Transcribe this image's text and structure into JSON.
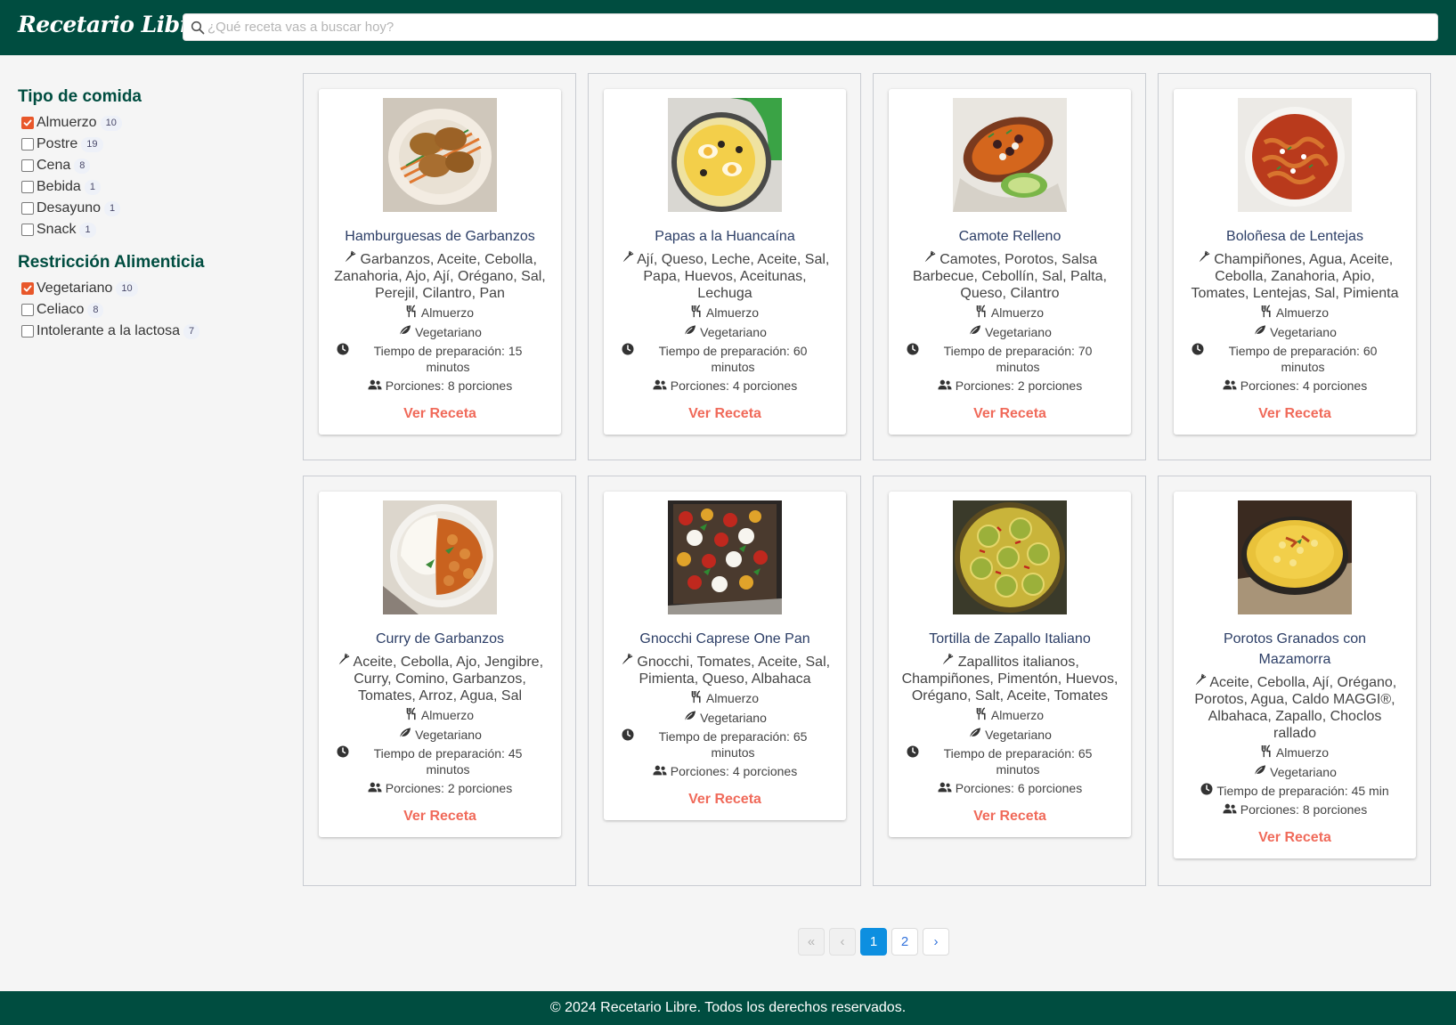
{
  "app": {
    "brand": "Recetario Libre"
  },
  "search": {
    "placeholder": "¿Qué receta vas a buscar hoy?"
  },
  "colors": {
    "primary": "#004d40",
    "accent": "#e8572a",
    "link": "#f06a5a",
    "active_page": "#0d8fe0"
  },
  "filters": {
    "tipo": {
      "title": "Tipo de comida",
      "items": [
        {
          "label": "Almuerzo",
          "count": "10",
          "checked": true
        },
        {
          "label": "Postre",
          "count": "19",
          "checked": false
        },
        {
          "label": "Cena",
          "count": "8",
          "checked": false
        },
        {
          "label": "Bebida",
          "count": "1",
          "checked": false
        },
        {
          "label": "Desayuno",
          "count": "1",
          "checked": false
        },
        {
          "label": "Snack",
          "count": "1",
          "checked": false
        }
      ]
    },
    "restriccion": {
      "title": "Restricción Alimenticia",
      "items": [
        {
          "label": "Vegetariano",
          "count": "10",
          "checked": true
        },
        {
          "label": "Celiaco",
          "count": "8",
          "checked": false
        },
        {
          "label": "Intolerante a la lactosa",
          "count": "7",
          "checked": false
        }
      ]
    }
  },
  "recipes": [
    {
      "title": "Hamburguesas de Garbanzos",
      "ingredients": "Garbanzos, Aceite, Cebolla, Zanahoria, Ajo, Ají, Orégano, Sal, Perejil, Cilantro, Pan",
      "meal": "Almuerzo",
      "diet": "Vegetariano",
      "time": "Tiempo de preparación: 15 minutos",
      "portions": "Porciones: 8 porciones",
      "cta": "Ver Receta",
      "image": "chickpea-patties-photo"
    },
    {
      "title": "Papas a la Huancaína",
      "ingredients": "Ají, Queso, Leche, Aceite, Sal, Papa, Huevos, Aceitunas, Lechuga",
      "meal": "Almuerzo",
      "diet": "Vegetariano",
      "time": "Tiempo de preparación: 60 minutos",
      "portions": "Porciones: 4 porciones",
      "cta": "Ver Receta",
      "image": "papas-huancaina-photo"
    },
    {
      "title": "Camote Relleno",
      "ingredients": "Camotes, Porotos, Salsa Barbecue, Cebollín, Sal, Palta, Queso, Cilantro",
      "meal": "Almuerzo",
      "diet": "Vegetariano",
      "time": "Tiempo de preparación: 70 minutos",
      "portions": "Porciones: 2 porciones",
      "cta": "Ver Receta",
      "image": "stuffed-sweet-potato-photo"
    },
    {
      "title": "Boloñesa de Lentejas",
      "ingredients": "Champiñones, Agua, Aceite, Cebolla, Zanahoria, Apio, Tomates, Lentejas, Sal, Pimienta",
      "meal": "Almuerzo",
      "diet": "Vegetariano",
      "time": "Tiempo de preparación: 60 minutos",
      "portions": "Porciones: 4 porciones",
      "cta": "Ver Receta",
      "image": "lentil-bolognese-photo"
    },
    {
      "title": "Curry de Garbanzos",
      "ingredients": "Aceite, Cebolla, Ajo, Jengibre, Curry, Comino, Garbanzos, Tomates, Arroz, Agua, Sal",
      "meal": "Almuerzo",
      "diet": "Vegetariano",
      "time": "Tiempo de preparación: 45 minutos",
      "portions": "Porciones: 2 porciones",
      "cta": "Ver Receta",
      "image": "chickpea-curry-photo"
    },
    {
      "title": "Gnocchi Caprese One Pan",
      "ingredients": "Gnocchi, Tomates, Aceite, Sal, Pimienta, Queso, Albahaca",
      "meal": "Almuerzo",
      "diet": "Vegetariano",
      "time": "Tiempo de preparación: 65 minutos",
      "portions": "Porciones: 4 porciones",
      "cta": "Ver Receta",
      "image": "gnocchi-caprese-photo"
    },
    {
      "title": "Tortilla de Zapallo Italiano",
      "ingredients": "Zapallitos italianos, Champiñones, Pimentón, Huevos, Orégano, Salt, Aceite, Tomates",
      "meal": "Almuerzo",
      "diet": "Vegetariano",
      "time": "Tiempo de preparación: 65 minutos",
      "portions": "Porciones: 6 porciones",
      "cta": "Ver Receta",
      "image": "zucchini-tortilla-photo"
    },
    {
      "title": "Porotos Granados con Mazamorra",
      "ingredients": "Aceite, Cebolla, Ají, Orégano, Porotos, Agua, Caldo MAGGI®, Albahaca, Zapallo, Choclos rallado",
      "meal": "Almuerzo",
      "diet": "Vegetariano",
      "time": "Tiempo de preparación: 45 min",
      "portions": "Porciones: 8 porciones",
      "cta": "Ver Receta",
      "image": "porotos-granados-photo"
    }
  ],
  "pagination": {
    "first": "«",
    "prev": "‹",
    "pages": [
      "1",
      "2"
    ],
    "current": "1",
    "next": "›"
  },
  "footer": {
    "text": "© 2024 Recetario Libre. Todos los derechos reservados."
  }
}
